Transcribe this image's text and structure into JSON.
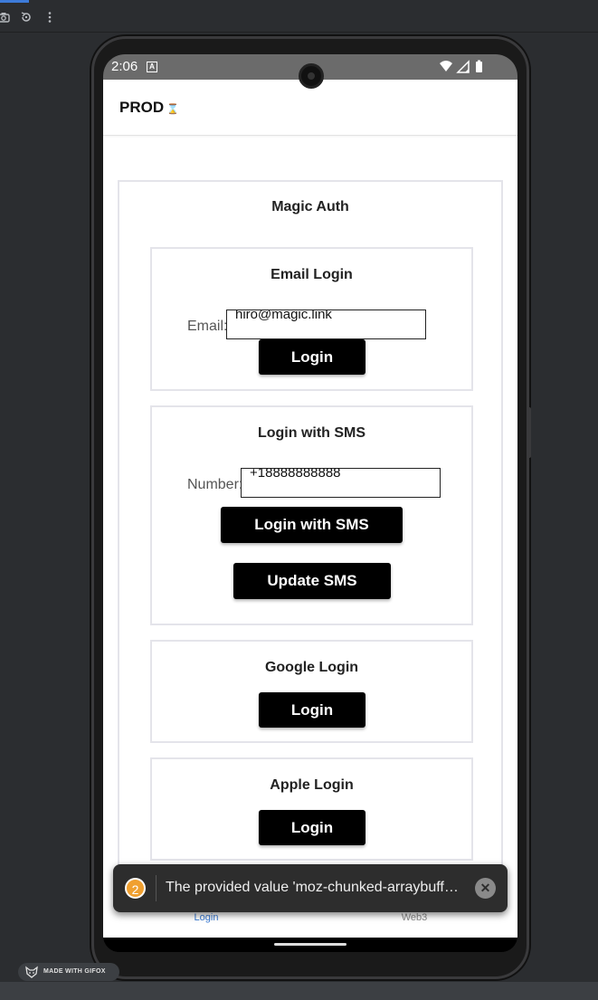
{
  "status_bar": {
    "time": "2:06",
    "notification_letter": "A"
  },
  "app": {
    "title": "PROD",
    "title_icon": "⌛"
  },
  "magic_auth": {
    "title": "Magic Auth",
    "email_login": {
      "title": "Email Login",
      "label": "Email:",
      "value": "hiro@magic.link",
      "button": "Login"
    },
    "sms_login": {
      "title": "Login with SMS",
      "label": "Number:",
      "value": "+18888888888",
      "login_button": "Login with SMS",
      "update_button": "Update SMS"
    },
    "google_login": {
      "title": "Google Login",
      "button": "Login"
    },
    "apple_login": {
      "title": "Apple Login",
      "button": "Login"
    }
  },
  "tabs": [
    {
      "label": "Login",
      "icon": "login-tab-icon",
      "active": true,
      "color": "#3a7bd5"
    },
    {
      "label": "Web3",
      "icon": "web3-tab-icon",
      "active": false,
      "color": "#8a8a8a"
    }
  ],
  "toast": {
    "count": "2",
    "message": "The provided value 'moz-chunked-arraybuffer' i..."
  },
  "watermark": "MADE WITH GIFOX"
}
